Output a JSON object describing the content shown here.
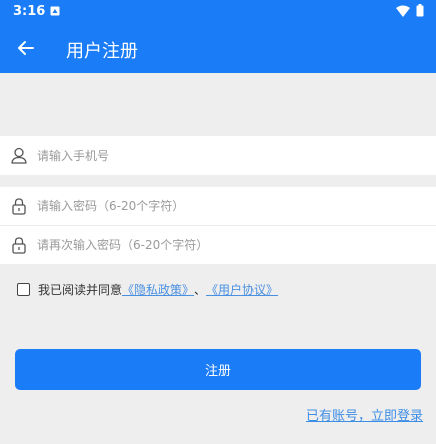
{
  "status_bar": {
    "time": "3:16",
    "icons": [
      "notification-icon",
      "wifi-icon",
      "battery-icon"
    ]
  },
  "header": {
    "back_icon": "arrow-left-icon",
    "title": "用户注册"
  },
  "form": {
    "phone": {
      "icon": "user-icon",
      "value": "",
      "placeholder": "请输入手机号"
    },
    "password": {
      "icon": "lock-icon",
      "value": "",
      "placeholder": "请输入密码（6-20个字符）"
    },
    "confirm_password": {
      "icon": "lock-icon",
      "value": "",
      "placeholder": "请再次输入密码（6-20个字符）"
    }
  },
  "agreement": {
    "checked": false,
    "prefix": "我已阅读并同意",
    "privacy_link": "《隐私政策》",
    "separator": "、",
    "user_agreement_link": "《用户协议》"
  },
  "submit_label": "注册",
  "login_link": "已有账号，立即登录",
  "colors": {
    "primary": "#1a7cf7",
    "background": "#eeeeee",
    "link": "#4a90e2"
  }
}
